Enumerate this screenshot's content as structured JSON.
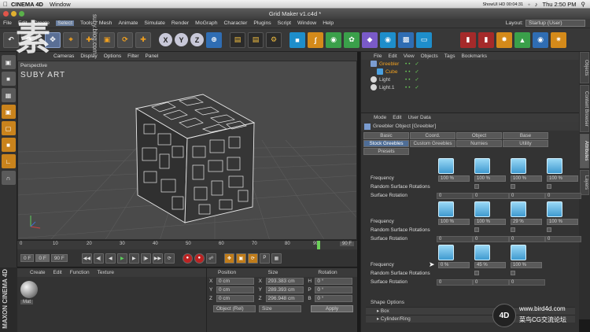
{
  "macbar": {
    "app_name": "CINEMA 4D",
    "menu_item": "Window",
    "clock": "Thu 2:50 PM",
    "status_text": "ShowUI HD 00:04:31"
  },
  "window": {
    "title": "Grid Maker v1.c4d *"
  },
  "app_menu": {
    "items": [
      "File",
      "Edit",
      "Create",
      "Select",
      "Tools",
      "Mesh",
      "Animate",
      "Simulate",
      "Render",
      "MoGraph",
      "Character",
      "Plugins",
      "Script",
      "Window",
      "Help"
    ],
    "layout_label": "Layout:",
    "layout_value": "Startup (User)"
  },
  "toolbar": {
    "axis_x": "X",
    "axis_y": "Y",
    "axis_z": "Z"
  },
  "viewport": {
    "menu": [
      "Cameras",
      "Display",
      "Options",
      "Filter",
      "Panel"
    ],
    "view_label": "Perspective"
  },
  "watermark": {
    "glyph": "素",
    "brand": "SUBY ART",
    "url": "suby.blog.com"
  },
  "timeline": {
    "ticks": [
      "0",
      "10",
      "20",
      "30",
      "40",
      "50",
      "60",
      "70",
      "80",
      "90"
    ],
    "end_label": "90 F",
    "current_frame": 90
  },
  "transport": {
    "start": "0 F",
    "current": "0 F",
    "end": "90 F"
  },
  "material_manager": {
    "menu": [
      "Create",
      "Edit",
      "Function",
      "Texture"
    ],
    "material_name": "Mat"
  },
  "coordinates": {
    "headers": [
      "Position",
      "Size",
      "Rotation"
    ],
    "rows": [
      {
        "axis": "X",
        "pos": "0 cm",
        "size_axis": "X",
        "size": "293.383 cm",
        "rot_axis": "H",
        "rot": "0 °"
      },
      {
        "axis": "Y",
        "pos": "0 cm",
        "size_axis": "Y",
        "size": "289.393 cm",
        "rot_axis": "P",
        "rot": "0 °"
      },
      {
        "axis": "Z",
        "pos": "0 cm",
        "size_axis": "Z",
        "size": "296.948 cm",
        "rot_axis": "B",
        "rot": "0 °"
      }
    ],
    "mode": "Object (Rel)",
    "size_mode": "Size",
    "apply": "Apply"
  },
  "object_manager": {
    "menu": [
      "File",
      "Edit",
      "View",
      "Objects",
      "Tags",
      "Bookmarks"
    ],
    "objects": [
      {
        "name": "Greebler",
        "selected": true,
        "color": "#f0a020"
      },
      {
        "name": "Cube",
        "selected": true,
        "color": "#f0a020"
      },
      {
        "name": "Light",
        "selected": false,
        "color": "#e0e0e0"
      },
      {
        "name": "Light.1",
        "selected": false,
        "color": "#e0e0e0"
      }
    ]
  },
  "side_tabs": [
    "Objects",
    "Content Browser",
    "Attributes",
    "Layers"
  ],
  "attributes": {
    "menu": [
      "Mode",
      "Edit",
      "User Data"
    ],
    "title": "Greebler Object [Greebler]",
    "tabs": [
      "Basic",
      "Coord.",
      "Object",
      "Base",
      "Stock Greebles",
      "Custom Greebles",
      "Nurnies",
      "Utility",
      "Presets"
    ],
    "active_tab": "Stock Greebles",
    "rows": [
      {
        "frequency_label": "Frequency",
        "random_label": "Random Surface Rotations",
        "rotation_label": "Surface Rotation",
        "values": [
          "100 %",
          "100 %",
          "100 %",
          "100 %"
        ],
        "rotations": [
          "0",
          "0",
          "0",
          "0"
        ]
      },
      {
        "frequency_label": "Frequency",
        "random_label": "Random Surface Rotations",
        "rotation_label": "Surface Rotation",
        "values": [
          "100 %",
          "100 %",
          "29 %",
          "100 %"
        ],
        "rotations": [
          "0",
          "0",
          "0",
          "0"
        ]
      },
      {
        "frequency_label": "Frequency",
        "random_label": "Random Surface Rotations",
        "rotation_label": "Surface Rotation",
        "values": [
          "0 %",
          "45 %",
          "100 %"
        ],
        "rotations": [
          "0",
          "0",
          "0"
        ]
      }
    ],
    "shape_options": {
      "header": "Shape Options",
      "items": [
        "▸ Box",
        "▸ Cylinder/Ring"
      ]
    }
  },
  "bottom_watermark": {
    "logo": "4D",
    "url": "www.bird4d.com",
    "cn": "菜鸟CG交流论坛"
  },
  "brand_vertical": "MAXON CINEMA 4D"
}
